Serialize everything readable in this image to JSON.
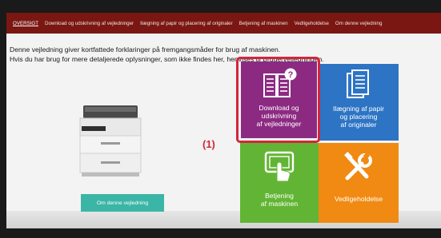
{
  "header": {
    "tabs": [
      {
        "label": "OVERSIGT",
        "active": true
      },
      {
        "label": "Download og udskrivning af vejledninger",
        "active": false
      },
      {
        "label": "Ilægning af papir og placering af originaler",
        "active": false
      },
      {
        "label": "Betjening af maskinen",
        "active": false
      },
      {
        "label": "Vedligeholdelse",
        "active": false
      },
      {
        "label": "Om denne vejledning",
        "active": false
      }
    ],
    "color": "#7a1712"
  },
  "intro": {
    "line1": "Denne vejledning giver kortfattede forklaringer på fremgangsmåder for brug af maskinen.",
    "line2": "Hvis du har brug for mere detaljerede oplysninger, som ikke findes her, henvises til Brugervejledningen."
  },
  "about_button": {
    "label": "Om denne vejledning",
    "color": "#3bb5a6"
  },
  "tiles": {
    "download": {
      "line1": "Download og",
      "line2": "udskrivning",
      "line3": "af vejledninger",
      "color": "#8c2a82",
      "icon": "document-question-icon"
    },
    "paper": {
      "line1": "Ilægning af papir",
      "line2": "og placering",
      "line3": "af originaler",
      "color": "#2d74c4",
      "icon": "documents-icon"
    },
    "operation": {
      "line1": "Betjening",
      "line2": "af maskinen",
      "color": "#62b534",
      "icon": "touch-panel-icon"
    },
    "maintenance": {
      "line1": "Vedligeholdelse",
      "color": "#f08a12",
      "icon": "tools-icon"
    }
  },
  "callout": {
    "label": "(1)",
    "color": "#d4253a"
  }
}
